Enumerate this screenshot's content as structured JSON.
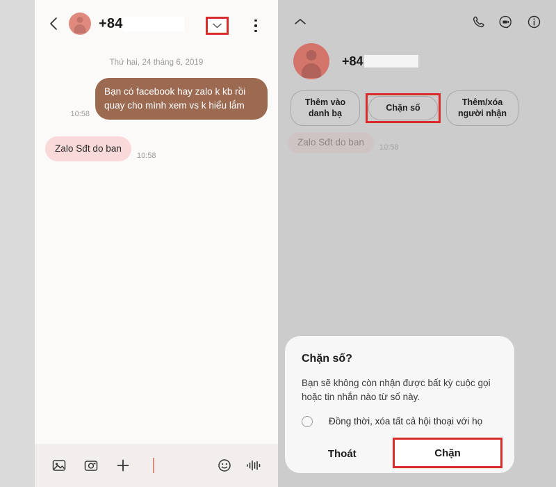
{
  "left_panel": {
    "header": {
      "back_icon": "chevron-left-icon",
      "contact_number": "+84",
      "expand_icon": "chevron-down-icon",
      "menu_icon": "kebab-menu-icon"
    },
    "date_separator": "Thứ hai, 24 tháng 6, 2019",
    "messages": [
      {
        "direction": "outgoing",
        "text": "Bạn có facebook hay zalo k kb rồi quay cho mình xem vs k hiểu lắm",
        "time": "10:58"
      },
      {
        "direction": "incoming",
        "text": "Zalo Sđt do ban",
        "time": "10:58"
      }
    ],
    "toolbar": {
      "gallery_icon": "image-icon",
      "camera_icon": "camera-icon",
      "add_icon": "plus-icon",
      "input_value": "",
      "emoji_icon": "smiley-icon",
      "voice_icon": "audio-waveform-icon"
    }
  },
  "right_panel": {
    "header": {
      "collapse_icon": "chevron-up-icon",
      "call_icon": "phone-icon",
      "video_icon": "video-call-icon",
      "info_icon": "info-circle-icon"
    },
    "contact": {
      "number": "+84",
      "avatar": "person-avatar"
    },
    "actions": [
      {
        "label": "Thêm vào danh bạ",
        "highlighted": false
      },
      {
        "label": "Chặn số",
        "highlighted": true
      },
      {
        "label": "Thêm/xóa người nhận",
        "highlighted": false
      }
    ],
    "message": {
      "text": "Zalo Sđt do ban",
      "time": "10:58"
    }
  },
  "dialog": {
    "title": "Chặn số?",
    "body": "Bạn sẽ không còn nhận được bất kỳ cuộc gọi hoặc tin nhắn nào từ số này.",
    "checkbox_label": "Đồng thời, xóa tất cả hội thoại với họ",
    "checkbox_checked": false,
    "cancel_label": "Thoát",
    "confirm_label": "Chặn",
    "confirm_highlighted": true
  },
  "colors": {
    "outgoing_bubble": "#9c6a51",
    "incoming_bubble": "#f9d9d9",
    "avatar": "#d4756c",
    "highlight": "#d92b2b",
    "dim_overlay": "#cccccc",
    "page_background": "#dadada"
  }
}
